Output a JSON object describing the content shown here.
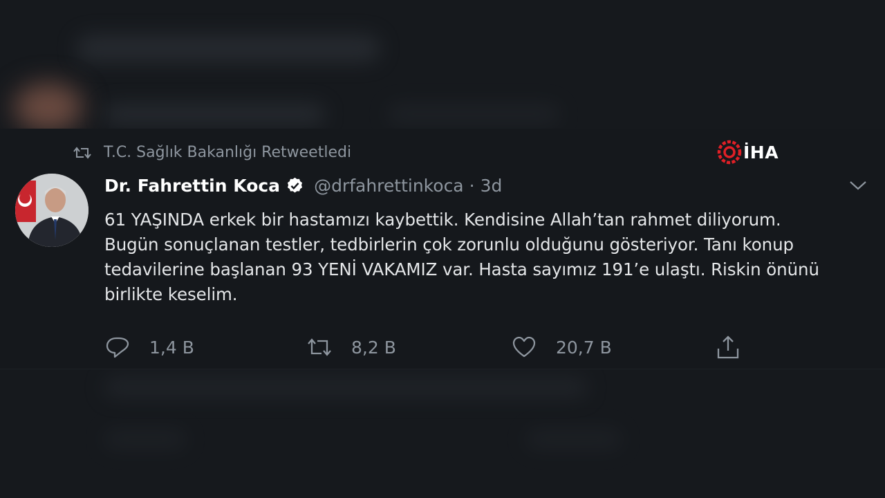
{
  "retweet_context": {
    "icon": "retweet-icon",
    "text": "T.C. Sağlık Bakanlığı Retweetledi"
  },
  "watermark": {
    "text": "İHA",
    "colors": {
      "mark": "#e01f26",
      "text": "#ffffff"
    }
  },
  "tweet": {
    "author_name": "Dr. Fahrettin Koca",
    "verified": true,
    "handle": "@drfahrettinkoca",
    "separator": "·",
    "time": "3d",
    "text": "61 YAŞINDA erkek bir hastamızı kaybettik. Kendisine Allah’tan rahmet diliyorum. Bugün sonuçlanan testler, tedbirlerin çok zorunlu olduğunu gösteriyor. Tanı konup tedavilerine başlanan 93 YENİ VAKAMIZ var. Hasta sayımız 191’e ulaştı. Riskin önünü birlikte keselim.",
    "actions": {
      "reply": {
        "icon": "reply-icon",
        "count": "1,4 B"
      },
      "retweet": {
        "icon": "retweet-icon",
        "count": "8,2 B"
      },
      "like": {
        "icon": "heart-icon",
        "count": "20,7 B"
      },
      "share": {
        "icon": "share-icon"
      }
    }
  },
  "colors": {
    "background": "#15181c",
    "text_primary": "#ffffff",
    "text_secondary": "#8e969f",
    "verified": "#ffffff"
  }
}
